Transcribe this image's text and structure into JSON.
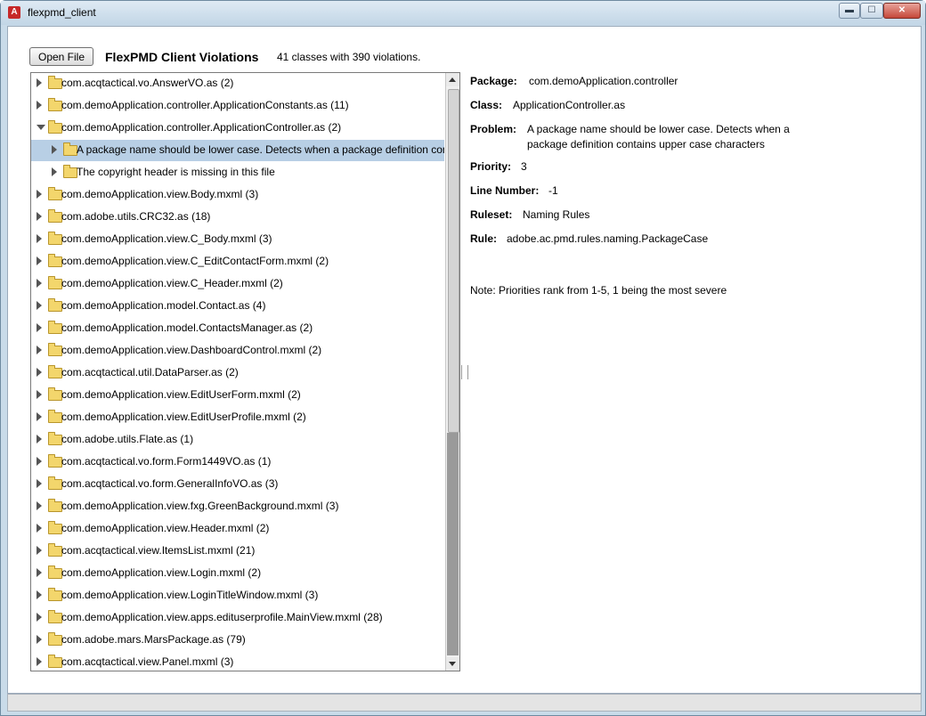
{
  "window": {
    "title": "flexpmd_client",
    "app_icon_glyph": "A",
    "min_glyph": "▬",
    "max_glyph": "☐",
    "close_glyph": "✕"
  },
  "toolbar": {
    "open_file_label": "Open File",
    "heading": "FlexPMD Client Violations",
    "summary": "41 classes with 390 violations."
  },
  "tree": {
    "rows": [
      {
        "label": "com.acqtactical.vo.AnswerVO.as (2)",
        "level": 0,
        "expanded": false,
        "selected": false
      },
      {
        "label": "com.demoApplication.controller.ApplicationConstants.as (11)",
        "level": 0,
        "expanded": false,
        "selected": false
      },
      {
        "label": "com.demoApplication.controller.ApplicationController.as (2)",
        "level": 0,
        "expanded": true,
        "selected": false
      },
      {
        "label": "A package name should be lower case. Detects when a package definition contains upper case characters",
        "level": 1,
        "expanded": false,
        "selected": true
      },
      {
        "label": "The copyright header is missing in this file",
        "level": 1,
        "expanded": false,
        "selected": false
      },
      {
        "label": "com.demoApplication.view.Body.mxml (3)",
        "level": 0,
        "expanded": false,
        "selected": false
      },
      {
        "label": "com.adobe.utils.CRC32.as (18)",
        "level": 0,
        "expanded": false,
        "selected": false
      },
      {
        "label": "com.demoApplication.view.C_Body.mxml (3)",
        "level": 0,
        "expanded": false,
        "selected": false
      },
      {
        "label": "com.demoApplication.view.C_EditContactForm.mxml (2)",
        "level": 0,
        "expanded": false,
        "selected": false
      },
      {
        "label": "com.demoApplication.view.C_Header.mxml (2)",
        "level": 0,
        "expanded": false,
        "selected": false
      },
      {
        "label": "com.demoApplication.model.Contact.as (4)",
        "level": 0,
        "expanded": false,
        "selected": false
      },
      {
        "label": "com.demoApplication.model.ContactsManager.as (2)",
        "level": 0,
        "expanded": false,
        "selected": false
      },
      {
        "label": "com.demoApplication.view.DashboardControl.mxml (2)",
        "level": 0,
        "expanded": false,
        "selected": false
      },
      {
        "label": "com.acqtactical.util.DataParser.as (2)",
        "level": 0,
        "expanded": false,
        "selected": false
      },
      {
        "label": "com.demoApplication.view.EditUserForm.mxml (2)",
        "level": 0,
        "expanded": false,
        "selected": false
      },
      {
        "label": "com.demoApplication.view.EditUserProfile.mxml (2)",
        "level": 0,
        "expanded": false,
        "selected": false
      },
      {
        "label": "com.adobe.utils.Flate.as (1)",
        "level": 0,
        "expanded": false,
        "selected": false
      },
      {
        "label": "com.acqtactical.vo.form.Form1449VO.as (1)",
        "level": 0,
        "expanded": false,
        "selected": false
      },
      {
        "label": "com.acqtactical.vo.form.GeneralInfoVO.as (3)",
        "level": 0,
        "expanded": false,
        "selected": false
      },
      {
        "label": "com.demoApplication.view.fxg.GreenBackground.mxml (3)",
        "level": 0,
        "expanded": false,
        "selected": false
      },
      {
        "label": "com.demoApplication.view.Header.mxml (2)",
        "level": 0,
        "expanded": false,
        "selected": false
      },
      {
        "label": "com.acqtactical.view.ItemsList.mxml (21)",
        "level": 0,
        "expanded": false,
        "selected": false
      },
      {
        "label": "com.demoApplication.view.Login.mxml (2)",
        "level": 0,
        "expanded": false,
        "selected": false
      },
      {
        "label": "com.demoApplication.view.LoginTitleWindow.mxml (3)",
        "level": 0,
        "expanded": false,
        "selected": false
      },
      {
        "label": "com.demoApplication.view.apps.edituserprofile.MainView.mxml (28)",
        "level": 0,
        "expanded": false,
        "selected": false
      },
      {
        "label": "com.adobe.mars.MarsPackage.as (79)",
        "level": 0,
        "expanded": false,
        "selected": false
      },
      {
        "label": "com.acqtactical.view.Panel.mxml (3)",
        "level": 0,
        "expanded": false,
        "selected": false
      }
    ]
  },
  "details": {
    "package_key": "Package:",
    "package_val": "com.demoApplication.controller",
    "class_key": "Class:",
    "class_val": "ApplicationController.as",
    "problem_key": "Problem:",
    "problem_line1": "A package name should be lower case. Detects when a",
    "problem_line2": "package definition contains upper case characters",
    "priority_key": "Priority:",
    "priority_val": "3",
    "line_key": "Line Number:",
    "line_val": "-1",
    "ruleset_key": "Ruleset:",
    "ruleset_val": "Naming Rules",
    "rule_key": "Rule:",
    "rule_val": "adobe.ac.pmd.rules.naming.PackageCase",
    "note": "Note: Priorities rank from 1-5, 1 being the most severe"
  },
  "colors": {
    "selection": "#b8cfe5",
    "folder": "#f3d66c"
  }
}
